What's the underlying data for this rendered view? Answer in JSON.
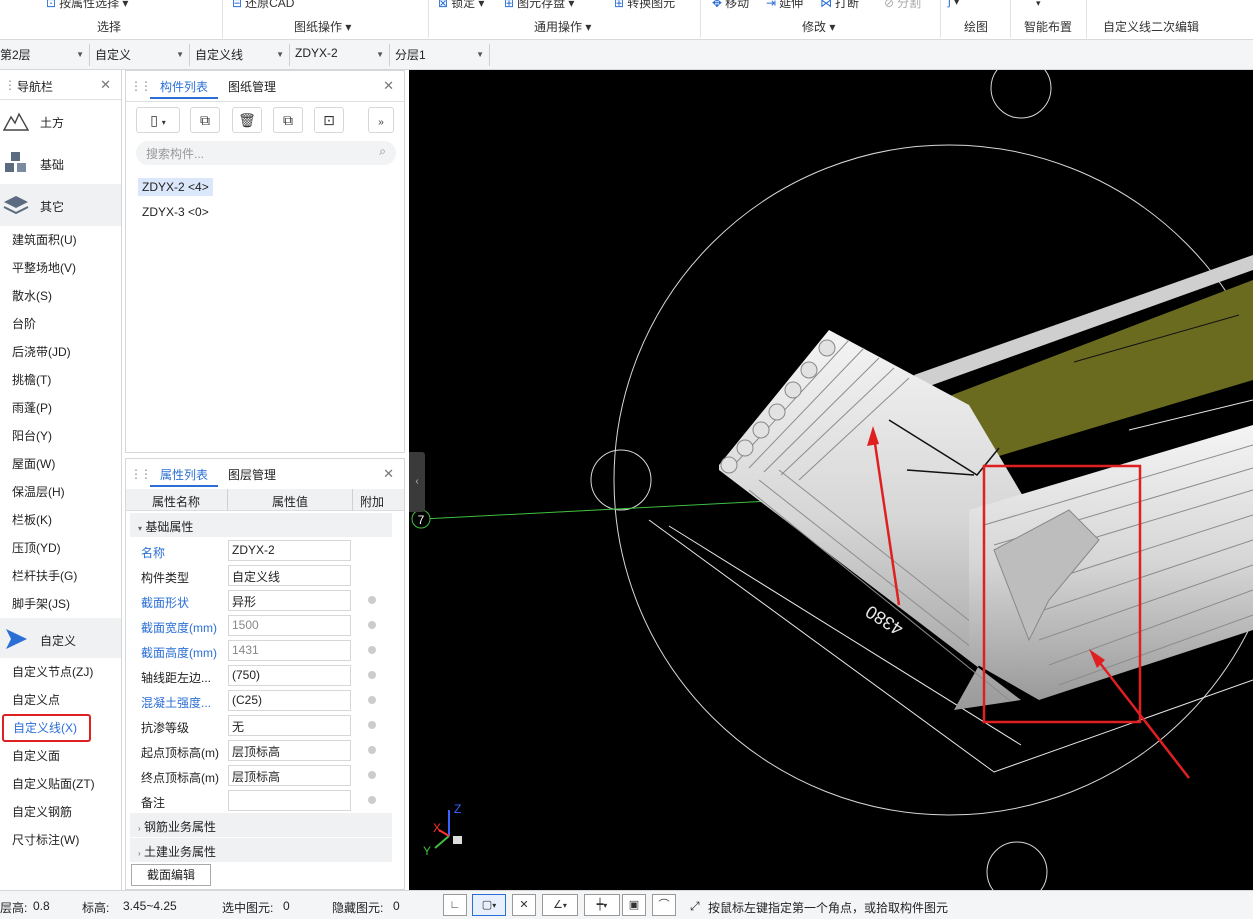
{
  "ribbon": {
    "top_items": [
      "按属性选择",
      "还原CAD",
      "锁定",
      "图元存盘",
      "转换图元",
      "移动",
      "延伸",
      "打断",
      "分割"
    ],
    "groups": [
      "选择",
      "图纸操作",
      "通用操作",
      "修改",
      "绘图",
      "智能布置",
      "自定义线二次编辑"
    ]
  },
  "selectors": [
    "第2层",
    "自定义",
    "自定义线",
    "ZDYX-2",
    "分层1"
  ],
  "nav": {
    "title": "导航栏",
    "categories": [
      "土方",
      "基础",
      "其它"
    ],
    "items": [
      "建筑面积(U)",
      "平整场地(V)",
      "散水(S)",
      "台阶",
      "后浇带(JD)",
      "挑檐(T)",
      "雨蓬(P)",
      "阳台(Y)",
      "屋面(W)",
      "保温层(H)",
      "栏板(K)",
      "压顶(YD)",
      "栏杆扶手(G)",
      "脚手架(JS)"
    ],
    "custom_category": "自定义",
    "custom_items": [
      "自定义节点(ZJ)",
      "自定义点",
      "自定义线(X)",
      "自定义面",
      "自定义贴面(ZT)",
      "自定义钢筋",
      "尺寸标注(W)"
    ]
  },
  "components": {
    "tabs": [
      "构件列表",
      "图纸管理"
    ],
    "search_placeholder": "搜索构件...",
    "list": [
      "ZDYX-2 <4>",
      "ZDYX-3 <0>"
    ]
  },
  "properties": {
    "tabs": [
      "属性列表",
      "图层管理"
    ],
    "headers": [
      "属性名称",
      "属性值",
      "附加"
    ],
    "section_basic": "基础属性",
    "rows": [
      {
        "name": "名称",
        "value": "ZDYX-2"
      },
      {
        "name": "构件类型",
        "value": "自定义线"
      },
      {
        "name": "截面形状",
        "value": "异形"
      },
      {
        "name": "截面宽度(mm)",
        "value": "1500"
      },
      {
        "name": "截面高度(mm)",
        "value": "1431"
      },
      {
        "name": "轴线距左边...",
        "value": "(750)"
      },
      {
        "name": "混凝土强度...",
        "value": "(C25)"
      },
      {
        "name": "抗渗等级",
        "value": "无"
      },
      {
        "name": "起点顶标高(m)",
        "value": "层顶标高"
      },
      {
        "name": "终点顶标高(m)",
        "value": "层顶标高"
      },
      {
        "name": "备注",
        "value": ""
      }
    ],
    "section_rebar": "钢筋业务属性",
    "section_civil": "土建业务属性",
    "edit_button": "截面编辑"
  },
  "viewport": {
    "axis_label": "7",
    "dimension": "4380",
    "axes": [
      "X",
      "Y",
      "Z"
    ]
  },
  "status": {
    "floor_height_label": "层高:",
    "floor_height": "0.8",
    "elevation_label": "标高:",
    "elevation": "3.45~4.25",
    "selected_label": "选中图元:",
    "selected": "0",
    "hidden_label": "隐藏图元:",
    "hidden": "0",
    "hint": "按鼠标左键指定第一个角点，或拾取构件图元"
  },
  "colors": {
    "accent": "#2b6fd6",
    "highlight": "#e02020"
  }
}
